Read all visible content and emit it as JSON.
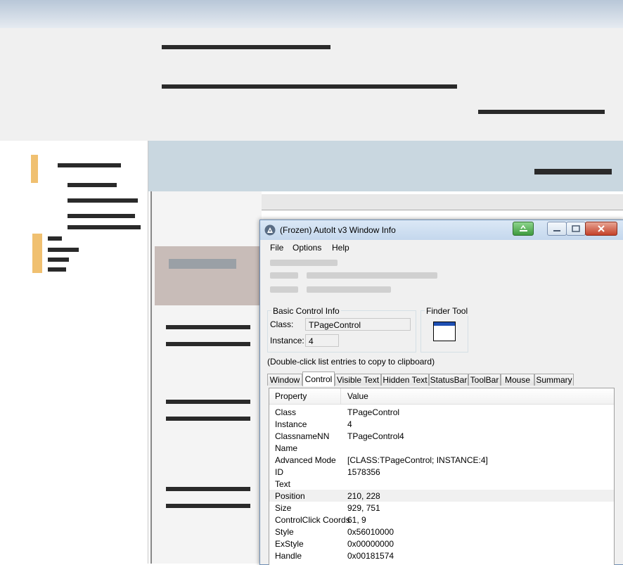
{
  "window": {
    "title": "(Frozen) AutoIt v3 Window Info"
  },
  "menu": [
    "File",
    "Options",
    "Help"
  ],
  "basic_control_info": {
    "group_label": "Basic Control Info",
    "class_label": "Class:",
    "class_value": "TPageControl",
    "instance_label": "Instance:",
    "instance_value": "4"
  },
  "finder_tool": {
    "label": "Finder Tool",
    "icon": "window-finder-icon"
  },
  "hint": "(Double-click list entries to copy to clipboard)",
  "tabs": [
    "Window",
    "Control",
    "Visible Text",
    "Hidden Text",
    "StatusBar",
    "ToolBar",
    "Mouse",
    "Summary"
  ],
  "active_tab": "Control",
  "list": {
    "columns": [
      "Property",
      "Value"
    ],
    "rows": [
      {
        "property": "Class",
        "value": "TPageControl"
      },
      {
        "property": "Instance",
        "value": "4"
      },
      {
        "property": "ClassnameNN",
        "value": "TPageControl4"
      },
      {
        "property": "Name",
        "value": ""
      },
      {
        "property": "Advanced Mode",
        "value": "[CLASS:TPageControl; INSTANCE:4]"
      },
      {
        "property": "ID",
        "value": "1578356"
      },
      {
        "property": "Text",
        "value": ""
      },
      {
        "property": "Position",
        "value": "210, 228"
      },
      {
        "property": "Size",
        "value": "929, 751"
      },
      {
        "property": "ControlClick Coords",
        "value": "61, 9"
      },
      {
        "property": "Style",
        "value": "0x56010000"
      },
      {
        "property": "ExStyle",
        "value": "0x00000000"
      },
      {
        "property": "Handle",
        "value": "0x00181574"
      }
    ]
  },
  "colors": {
    "title_bar": "#c4d7ed",
    "pin_button": "#3f9b3f",
    "close_button": "#c4412a",
    "finder_caption": "#1e4fb3",
    "alt_row": "#f0f0f0"
  }
}
